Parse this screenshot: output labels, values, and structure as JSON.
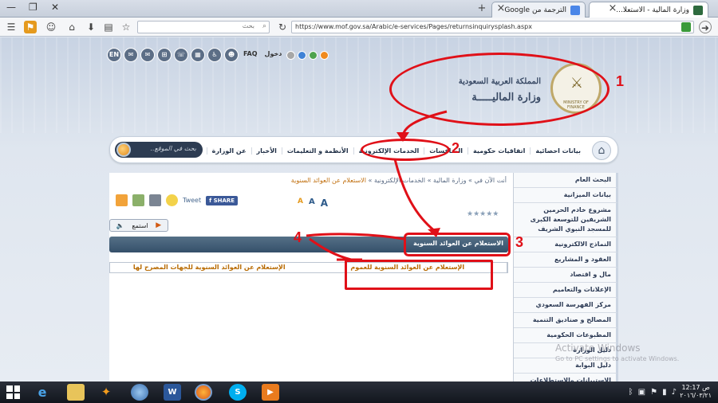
{
  "browser": {
    "tabs": [
      {
        "title": "وزارة المالية - الاستعلا...",
        "active": true
      },
      {
        "title": "الترجمة من Google",
        "active": false
      }
    ],
    "new_tab": "+",
    "tab_close": "×",
    "search_placeholder": "بحث",
    "url": "https://www.mof.gov.sa/Arabic/e-services/Pages/returnsinquirysplash.aspx"
  },
  "page": {
    "top_icons": [
      "EN",
      "FAQ",
      "دخول"
    ],
    "logo_line1": "المملكة العربية السعودية",
    "logo_line2": "وزارة الماليـــــة",
    "seal_text": "MINISTRY OF FINANCE",
    "nav": {
      "items": [
        "عن الوزارة",
        "الأخبار",
        "الأنظمة و التعليمات",
        "الخدمات الإلكترونية",
        "المنافسات",
        "اتفاقيات حكومية",
        "بيانات احصائية"
      ],
      "search_placeholder": "بحث في الموقع.."
    },
    "breadcrumb": {
      "parts": [
        "أنت الآن في",
        "وزارة المالية",
        "الخدمات الإلكترونية"
      ],
      "current": "الاستعلام عن العوائد السنوية",
      "sep": "»"
    },
    "font_sizes": [
      "A",
      "A",
      "A"
    ],
    "share": {
      "tweet": "Tweet",
      "fb": "SHARE"
    },
    "rating": "★★★★★",
    "listen_label": "استمع",
    "title": "الاستعلام عن العوائد السنوية",
    "links": [
      "الإستعلام عن العوائد السنوية للعموم",
      "الإستعلام عن العوائد السنوية للجهات المصرح لها"
    ],
    "sidebar": [
      "البحث العام",
      "بيانات الميزانية",
      "مشروع خادم الحرمين الشريفين للتوسعة الكبرى للمسجد النبوي الشريف",
      "النماذج الالكترونية",
      "العقود و المشاريع",
      "مال و اقتصاد",
      "الإعلانات والتعاميم",
      "مركز الفهرسة السعودي",
      "المصالح و صناديق التنمية",
      "المطبوعات الحكومية",
      "دليل الوزارة",
      "دليل البوابة",
      "الاستبيانات والاستطلاعات"
    ]
  },
  "annotations": {
    "n1": "1",
    "n2": "2",
    "n3": "3",
    "n4": "4",
    "color": "#e01018"
  },
  "watermark": {
    "line1": "Activate Windows",
    "line2": "Go to PC settings to activate Windows."
  },
  "taskbar": {
    "time": "12:17 ص",
    "date": "٢٠١٦/٠٣/٢١"
  }
}
